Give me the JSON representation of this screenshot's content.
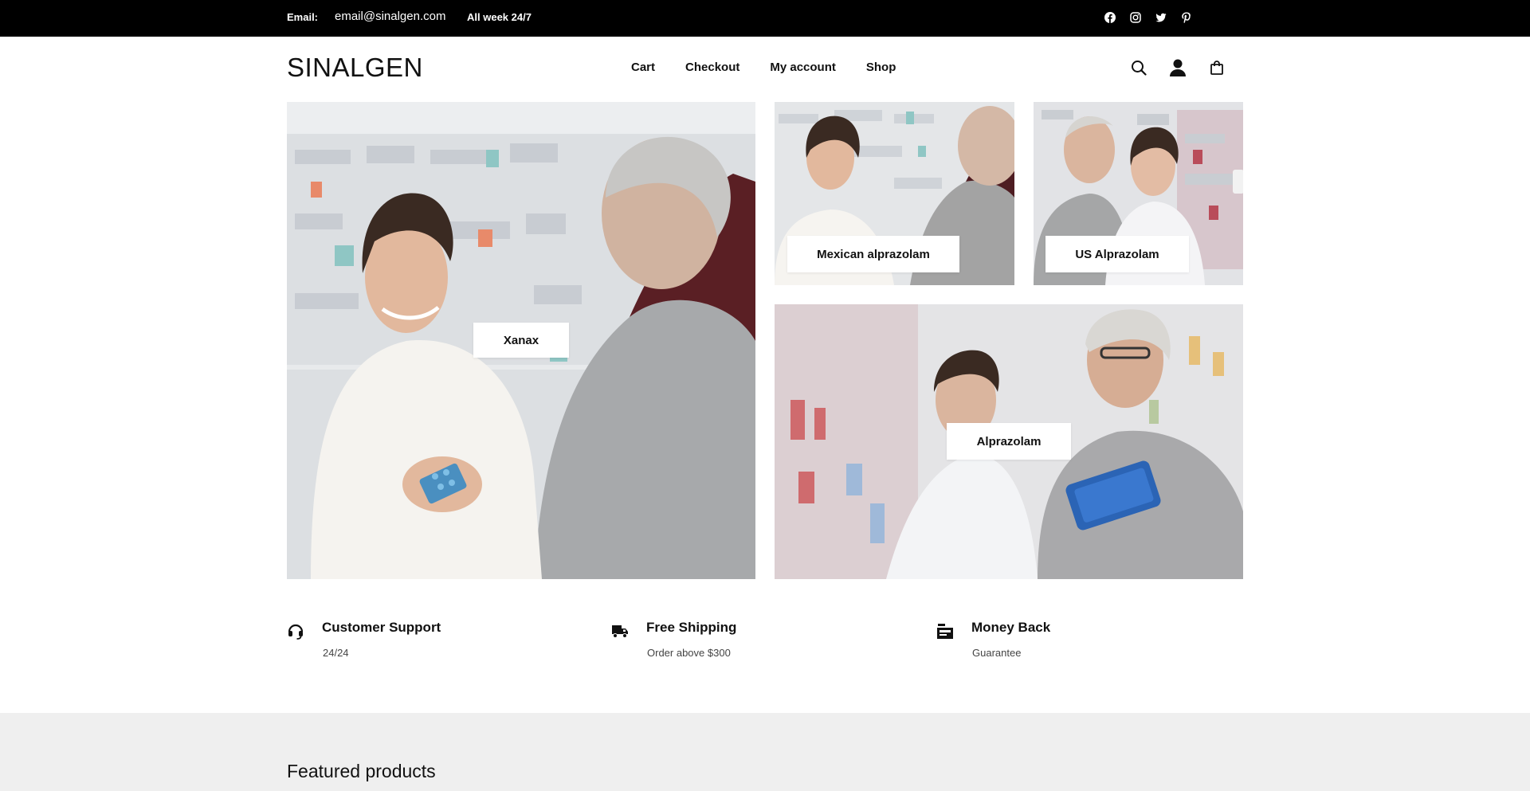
{
  "topbar": {
    "email_label": "Email:",
    "email_value": "email@sinalgen.com",
    "hours": "All week 24/7",
    "socials": [
      "facebook-icon",
      "instagram-icon",
      "twitter-icon",
      "pinterest-icon"
    ]
  },
  "header": {
    "logo": "SINALGEN",
    "nav": [
      "Cart",
      "Checkout",
      "My account",
      "Shop"
    ],
    "icons": [
      "search-icon",
      "user-icon",
      "bag-icon"
    ]
  },
  "banners": {
    "xanax": "Xanax",
    "mexican": "Mexican alprazolam",
    "us": "US Alprazolam",
    "alprazolam": "Alprazolam"
  },
  "features": [
    {
      "title": "Customer Support",
      "subtitle": "24/24",
      "icon": "headset-icon"
    },
    {
      "title": "Free Shipping",
      "subtitle": "Order above $300",
      "icon": "truck-icon"
    },
    {
      "title": "Money Back",
      "subtitle": "Guarantee",
      "icon": "register-icon"
    }
  ],
  "featured": {
    "title": "Featured products"
  },
  "colors": {
    "topbar_bg": "#000000",
    "section_bg": "#efefef",
    "text": "#111111"
  }
}
